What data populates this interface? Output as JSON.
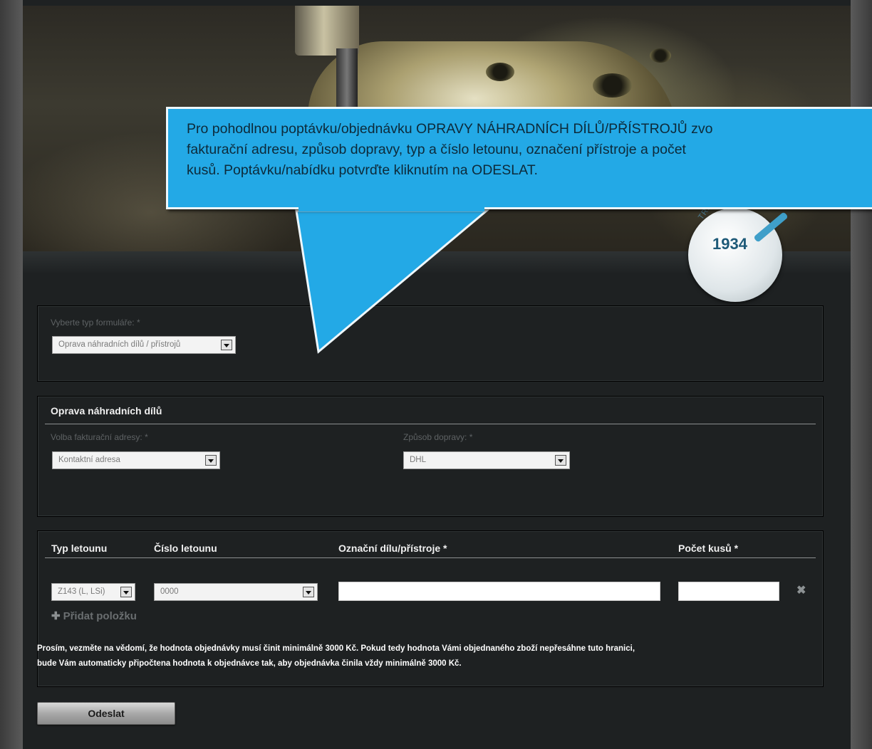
{
  "callout": {
    "line1": "Pro pohodlnou poptávku/objednávku OPRAVY NÁHRADNÍCH DÍLŮ/PŘÍSTROJŮ zvo",
    "line2": "fakturační adresu, způsob dopravy, typ a číslo letounu, označení přístroje a počet",
    "line3": "kusů. Poptávku/nabídku potvrďte kliknutím na ODESLAT."
  },
  "badge": {
    "year": "1934",
    "arc_text": "TRADITION SINCE"
  },
  "form_type": {
    "label": "Vyberte typ formuláře: *",
    "selected": "Oprava náhradních dílů / přístrojů"
  },
  "repair": {
    "title": "Oprava náhradních dílů",
    "billing_label": "Volba fakturační adresy: *",
    "billing_selected": "Kontaktní adresa",
    "shipping_label": "Způsob dopravy: *",
    "shipping_selected": "DHL"
  },
  "items": {
    "col_type": "Typ letounu",
    "col_number": "Číslo letounu",
    "col_part": "Označní dílu/přístroje *",
    "col_qty": "Počet kusů *",
    "row": {
      "type": "Z143 (L, LSi)",
      "number": "0000",
      "part": "",
      "qty": ""
    },
    "add_label": "Přidat položku",
    "remove_icon": "✖",
    "notice_line1": "Prosím, vezměte na vědomí, že hodnota objednávky musí činit minimálně 3000 Kč. Pokud tedy hodnota Vámi objednaného zboží nepřesáhne tuto hranici,",
    "notice_line2": "bude Vám automaticky připočtena hodnota k objednávce tak, aby objednávka činila vždy minimálně 3000 Kč."
  },
  "submit_label": "Odeslat"
}
